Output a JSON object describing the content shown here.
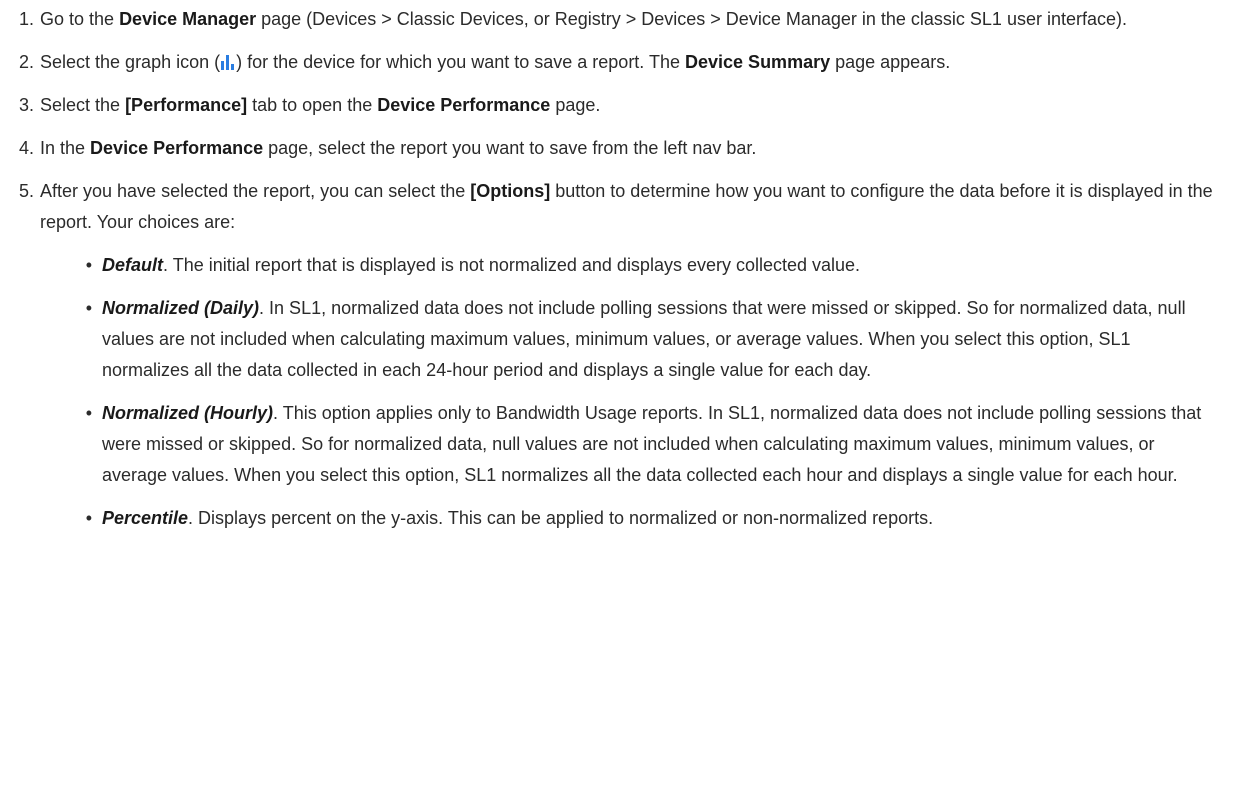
{
  "steps": [
    {
      "num": "1.",
      "t1": "Go to the ",
      "b1": "Device Manager",
      "t2": " page (Devices > Classic Devices, or Registry > Devices > Device Manager in the classic SL1 user interface)."
    },
    {
      "num": "2.",
      "t1": "Select the graph icon (",
      "icon": "bar-chart-icon",
      "t2": ") for the device for which you want to save a report. The ",
      "b1": "Device Summary",
      "t3": " page appears."
    },
    {
      "num": "3.",
      "t1": "Select the ",
      "b1": "[Performance]",
      "t2": " tab to open the ",
      "b2": "Device Performance",
      "t3": " page."
    },
    {
      "num": "4.",
      "t1": "In the ",
      "b1": "Device Performance",
      "t2": " page, select the report you want to save from the left nav bar."
    },
    {
      "num": "5.",
      "t1": "After you have selected the report, you can select the ",
      "b1": "[Options]",
      "t2": " button to determine how you want to configure the data before it is displayed in the report. Your choices are:",
      "options": [
        {
          "bullet": "•",
          "name": "Default",
          "text": ". The initial report that is displayed is not normalized and displays every collected value."
        },
        {
          "bullet": "•",
          "name": "Normalized (Daily)",
          "text": ". In SL1, normalized data does not include polling sessions that were missed or skipped. So for normalized data, null values are not included when calculating maximum values, minimum values, or average values. When you select this option, SL1 normalizes all the data collected in each 24-hour period and displays a single value for each day."
        },
        {
          "bullet": "•",
          "name": "Normalized (Hourly)",
          "text": ". This option applies only to Bandwidth Usage reports. In SL1, normalized data does not include polling sessions that were missed or skipped. So for normalized data, null values are not included when calculating maximum values, minimum values, or average values. When you select this option, SL1 normalizes all the data collected each hour and displays a single value for each hour."
        },
        {
          "bullet": "•",
          "name": "Percentile",
          "text": ". Displays percent on the y-axis. This can be applied to normalized or non-normalized reports."
        }
      ]
    }
  ]
}
